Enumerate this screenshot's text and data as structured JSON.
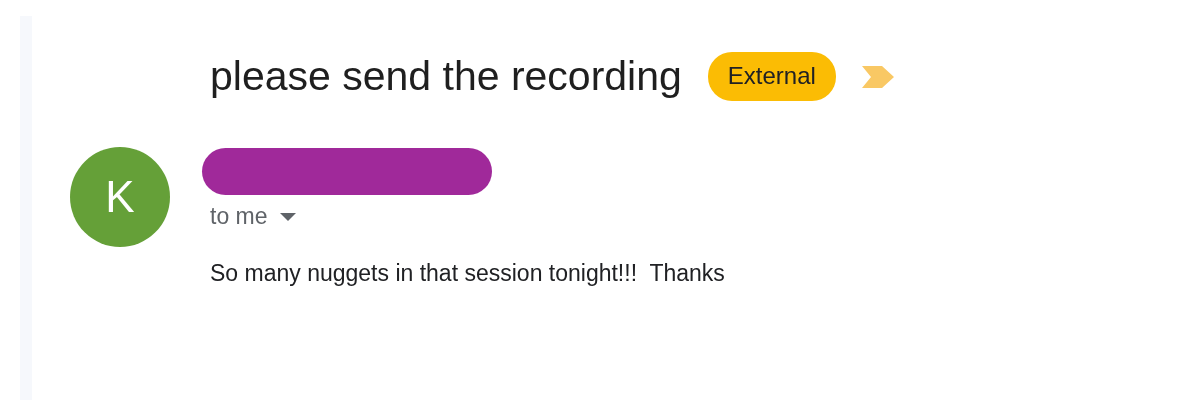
{
  "subject": "please send the recording",
  "label": {
    "text": "External"
  },
  "message": {
    "avatar_letter": "K",
    "sender": {
      "redacted": true
    },
    "recipient": "to me",
    "body": "So many nuggets in that session tonight!!!  Thanks"
  }
}
